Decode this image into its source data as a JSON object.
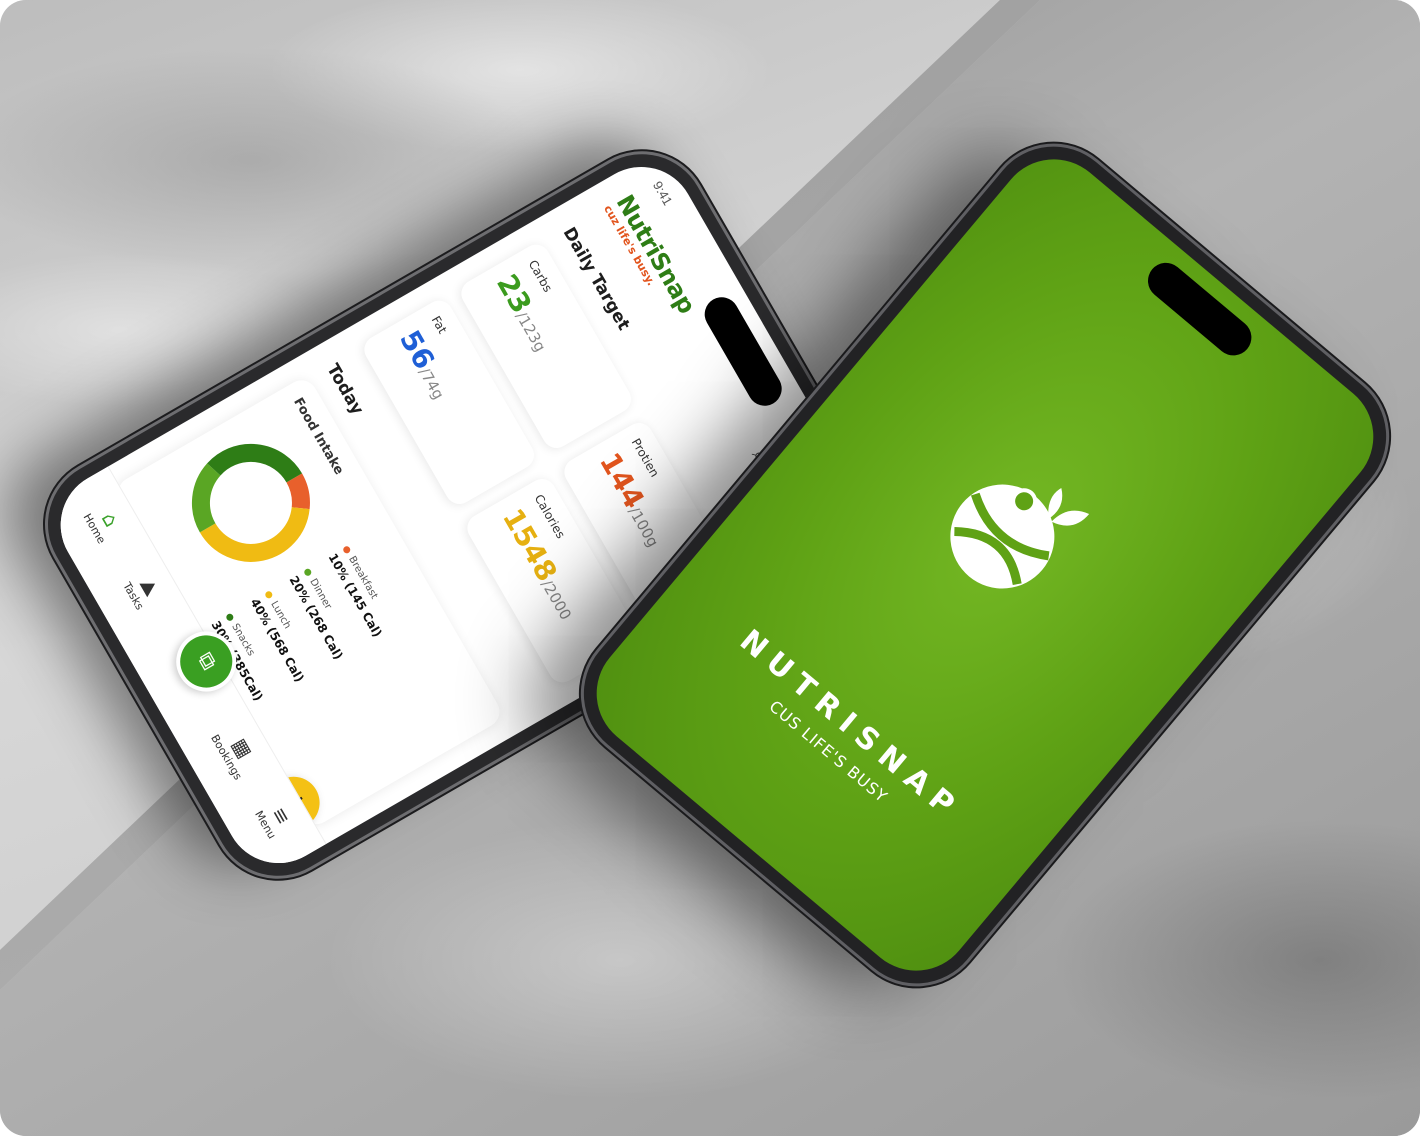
{
  "left_phone": {
    "status_time": "9:41",
    "brand_name": "NutriSnap",
    "brand_tagline": "cuz life's busy.",
    "daily_target_title": "Daily Target",
    "cards": {
      "carbs": {
        "label": "Carbs",
        "value": "23",
        "target": "/123g",
        "color": "#3b9b1e"
      },
      "protein": {
        "label": "Protien",
        "value": "144",
        "target": "/100g",
        "color": "#e2551e"
      },
      "fat": {
        "label": "Fat",
        "value": "56",
        "target": "/74g",
        "color": "#1f5fd6"
      },
      "calories": {
        "label": "Calories",
        "value": "1548",
        "target": "/2000",
        "color": "#e6b011"
      }
    },
    "today_title": "Today",
    "food_intake_title": "Food Intake",
    "food_intake": [
      {
        "name": "Breakfast",
        "value": "10% (145 Cal)",
        "percent": 10,
        "color": "#e8602c"
      },
      {
        "name": "Lunch",
        "value": "40% (568 Cal)",
        "percent": 40,
        "color": "#f0bb13"
      },
      {
        "name": "Dinner",
        "value": "20% (268 Cal)",
        "percent": 20,
        "color": "#5aa624"
      },
      {
        "name": "Snacks",
        "value": "30% (385Cal)",
        "percent": 30,
        "color": "#2e7d16"
      }
    ],
    "pager": {
      "pages": 4,
      "active": 1
    },
    "nav": {
      "home": "Home",
      "tasks": "Tasks",
      "bookings": "Bookings",
      "menu": "Menu"
    },
    "icons": {
      "search": "search-icon",
      "chat": "chat-icon",
      "notification": "bell-icon",
      "add": "plus-icon",
      "scan": "scan-icon"
    }
  },
  "right_phone": {
    "app_name": "NUTRISNAP",
    "tagline": "CUS LIFE'S BUSY",
    "background_color": "#5fa215"
  }
}
